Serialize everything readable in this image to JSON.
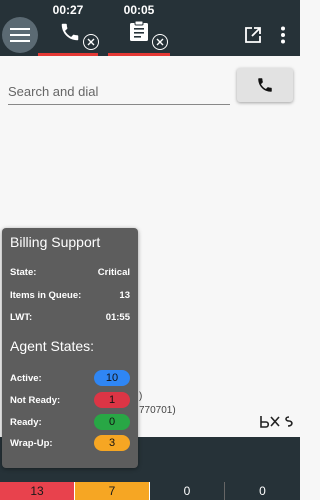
{
  "header": {
    "sessions": [
      {
        "timer": "00:27",
        "icon": "phone-icon"
      },
      {
        "timer": "00:05",
        "icon": "clipboard-icon"
      }
    ],
    "right_icons": [
      "open-in-new-icon",
      "more-vert-icon"
    ]
  },
  "dial": {
    "placeholder": "Search and dial"
  },
  "background_text": {
    "line1": ")",
    "line2": "770701)"
  },
  "queue_card": {
    "title": "Billing Support",
    "rows": [
      {
        "label": "State:",
        "value": "Critical"
      },
      {
        "label": "Items in Queue:",
        "value": "13"
      },
      {
        "label": "LWT:",
        "value": "01:55"
      }
    ],
    "agent_states_title": "Agent States:",
    "agent_states": [
      {
        "label": "Active:",
        "value": "10",
        "color": "#2f86f4"
      },
      {
        "label": "Not Ready:",
        "value": "1",
        "color": "#dc3545"
      },
      {
        "label": "Ready:",
        "value": "0",
        "color": "#28a745"
      },
      {
        "label": "Wrap-Up:",
        "value": "3",
        "color": "#f6a623"
      }
    ]
  },
  "stats_bar": [
    "13",
    "7",
    "0",
    "0"
  ],
  "colors": {
    "topbar": "#263238",
    "accent_red": "#e53935"
  }
}
